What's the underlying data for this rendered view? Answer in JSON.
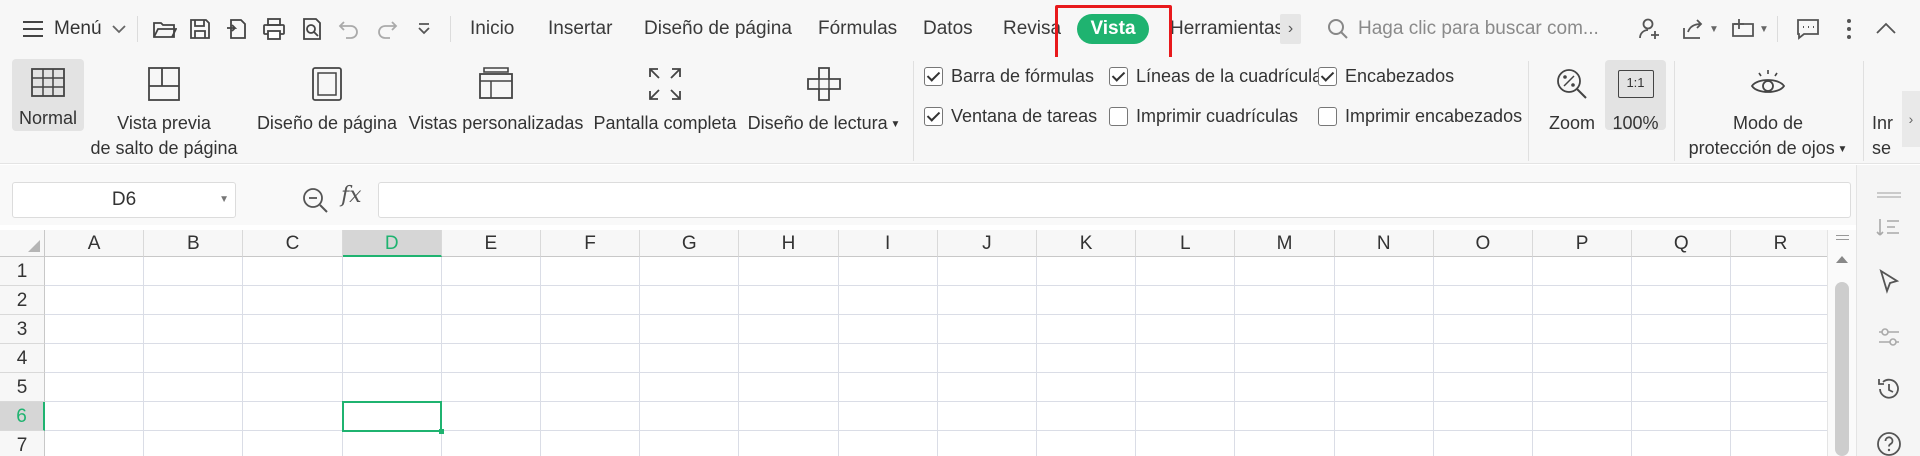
{
  "menubar": {
    "menu_label": "Menú",
    "tabs": [
      "Inicio",
      "Insertar",
      "Diseño de página",
      "Fórmulas",
      "Datos",
      "Revisar",
      "Vista",
      "Herramientas"
    ],
    "active_tab": "Vista",
    "more_tabs": "›",
    "search_placeholder": "Haga clic para buscar com..."
  },
  "ribbon": {
    "buttons": {
      "normal": "Normal",
      "page_break_1": "Vista previa",
      "page_break_2": "de salto de página",
      "page_layout": "Diseño de página",
      "custom_views": "Vistas personalizadas",
      "full_screen": "Pantalla completa",
      "reading_layout": "Diseño de lectura",
      "zoom": "Zoom",
      "zoom_100": "100%",
      "zoom_100_icon": "1:1",
      "eye_protection_1": "Modo de",
      "eye_protection_2": "protección de ojos",
      "cut_1": "Inr",
      "cut_2": "se"
    },
    "checkboxes": [
      {
        "label": "Barra de fórmulas",
        "checked": true
      },
      {
        "label": "Líneas de la cuadrícula",
        "checked": true
      },
      {
        "label": "Encabezados",
        "checked": true
      },
      {
        "label": "Ventana de tareas",
        "checked": true
      },
      {
        "label": "Imprimir cuadrículas",
        "checked": false
      },
      {
        "label": "Imprimir encabezados",
        "checked": false
      }
    ]
  },
  "formula_bar": {
    "name_box": "D6",
    "fx": "fx",
    "formula": ""
  },
  "grid": {
    "columns": [
      "A",
      "B",
      "C",
      "D",
      "E",
      "F",
      "G",
      "H",
      "I",
      "J",
      "K",
      "L",
      "M",
      "N",
      "O",
      "P",
      "Q",
      "R"
    ],
    "rows": [
      "1",
      "2",
      "3",
      "4",
      "5",
      "6",
      "7"
    ],
    "active_column": "D",
    "active_row": "6"
  },
  "colors": {
    "accent": "#1fb370",
    "highlight_box": "#e8191c"
  }
}
